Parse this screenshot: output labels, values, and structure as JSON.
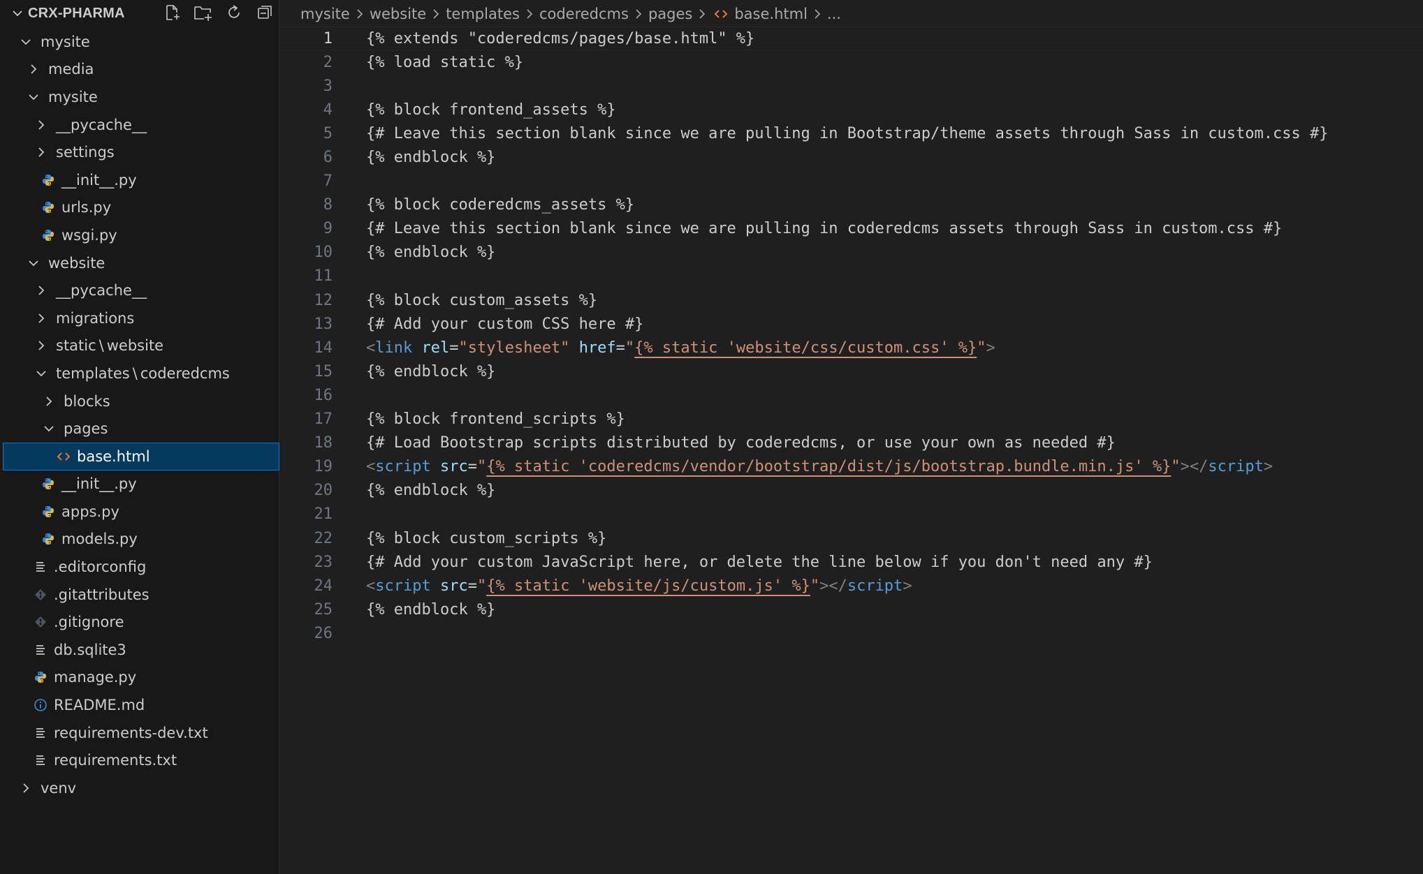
{
  "explorer": {
    "title": "CRX-PHARMA",
    "actions": [
      {
        "name": "new-file-icon"
      },
      {
        "name": "new-folder-icon"
      },
      {
        "name": "refresh-icon"
      },
      {
        "name": "collapse-all-icon"
      }
    ],
    "tree": [
      {
        "label": "mysite",
        "depth": 0,
        "kind": "folder",
        "open": true
      },
      {
        "label": "media",
        "depth": 1,
        "kind": "folder",
        "open": false
      },
      {
        "label": "mysite",
        "depth": 1,
        "kind": "folder",
        "open": true
      },
      {
        "label": "__pycache__",
        "depth": 2,
        "kind": "folder",
        "open": false
      },
      {
        "label": "settings",
        "depth": 2,
        "kind": "folder",
        "open": false
      },
      {
        "label": "__init__.py",
        "depth": 2,
        "kind": "python"
      },
      {
        "label": "urls.py",
        "depth": 2,
        "kind": "python"
      },
      {
        "label": "wsgi.py",
        "depth": 2,
        "kind": "python"
      },
      {
        "label": "website",
        "depth": 1,
        "kind": "folder",
        "open": true
      },
      {
        "label": "__pycache__",
        "depth": 2,
        "kind": "folder",
        "open": false
      },
      {
        "label": "migrations",
        "depth": 2,
        "kind": "folder",
        "open": false
      },
      {
        "label": "static",
        "label2": "website",
        "depth": 2,
        "kind": "folder",
        "open": false
      },
      {
        "label": "templates",
        "label2": "coderedcms",
        "depth": 2,
        "kind": "folder",
        "open": true
      },
      {
        "label": "blocks",
        "depth": 3,
        "kind": "folder",
        "open": false
      },
      {
        "label": "pages",
        "depth": 3,
        "kind": "folder",
        "open": true
      },
      {
        "label": "base.html",
        "depth": 4,
        "kind": "html",
        "selected": true
      },
      {
        "label": "__init__.py",
        "depth": 2,
        "kind": "python"
      },
      {
        "label": "apps.py",
        "depth": 2,
        "kind": "python"
      },
      {
        "label": "models.py",
        "depth": 2,
        "kind": "python"
      },
      {
        "label": ".editorconfig",
        "depth": 1,
        "kind": "lines"
      },
      {
        "label": ".gitattributes",
        "depth": 1,
        "kind": "git"
      },
      {
        "label": ".gitignore",
        "depth": 1,
        "kind": "git"
      },
      {
        "label": "db.sqlite3",
        "depth": 1,
        "kind": "lines"
      },
      {
        "label": "manage.py",
        "depth": 1,
        "kind": "python"
      },
      {
        "label": "README.md",
        "depth": 1,
        "kind": "info"
      },
      {
        "label": "requirements-dev.txt",
        "depth": 1,
        "kind": "lines"
      },
      {
        "label": "requirements.txt",
        "depth": 1,
        "kind": "lines"
      },
      {
        "label": "venv",
        "depth": 0,
        "kind": "folder",
        "open": false
      }
    ]
  },
  "breadcrumb": {
    "items": [
      "mysite",
      "website",
      "templates",
      "coderedcms",
      "pages",
      "base.html",
      "..."
    ]
  },
  "editor": {
    "current_line": 1,
    "lines": [
      [
        {
          "t": "plain",
          "v": "{% extends \"coderedcms/pages/base.html\" %}"
        }
      ],
      [
        {
          "t": "plain",
          "v": "{% load static %}"
        }
      ],
      [],
      [
        {
          "t": "plain",
          "v": "{% block frontend_assets %}"
        }
      ],
      [
        {
          "t": "plain",
          "v": "{# Leave this section blank since we are pulling in Bootstrap/theme assets through Sass in custom.css #}"
        }
      ],
      [
        {
          "t": "plain",
          "v": "{% endblock %}"
        }
      ],
      [],
      [
        {
          "t": "plain",
          "v": "{% block coderedcms_assets %}"
        }
      ],
      [
        {
          "t": "plain",
          "v": "{# Leave this section blank since we are pulling in coderedcms assets through Sass in custom.css #}"
        }
      ],
      [
        {
          "t": "plain",
          "v": "{% endblock %}"
        }
      ],
      [],
      [
        {
          "t": "plain",
          "v": "{% block custom_assets %}"
        }
      ],
      [
        {
          "t": "plain",
          "v": "{# Add your custom CSS here #}"
        }
      ],
      [
        {
          "t": "punct",
          "v": "<"
        },
        {
          "t": "tag",
          "v": "link"
        },
        {
          "t": "plain",
          "v": " "
        },
        {
          "t": "attr",
          "v": "rel"
        },
        {
          "t": "plain",
          "v": "="
        },
        {
          "t": "str",
          "v": "\"stylesheet\""
        },
        {
          "t": "plain",
          "v": " "
        },
        {
          "t": "attr",
          "v": "href"
        },
        {
          "t": "plain",
          "v": "="
        },
        {
          "t": "str",
          "v": "\""
        },
        {
          "t": "tpl",
          "v": "{% static 'website/css/custom.css' %}"
        },
        {
          "t": "str",
          "v": "\""
        },
        {
          "t": "punct",
          "v": ">"
        }
      ],
      [
        {
          "t": "plain",
          "v": "{% endblock %}"
        }
      ],
      [],
      [
        {
          "t": "plain",
          "v": "{% block frontend_scripts %}"
        }
      ],
      [
        {
          "t": "plain",
          "v": "{# Load Bootstrap scripts distributed by coderedcms, or use your own as needed #}"
        }
      ],
      [
        {
          "t": "punct",
          "v": "<"
        },
        {
          "t": "tag",
          "v": "script"
        },
        {
          "t": "plain",
          "v": " "
        },
        {
          "t": "attr",
          "v": "src"
        },
        {
          "t": "plain",
          "v": "="
        },
        {
          "t": "str",
          "v": "\""
        },
        {
          "t": "tpl",
          "v": "{% static 'coderedcms/vendor/bootstrap/dist/js/bootstrap.bundle.min.js' %}"
        },
        {
          "t": "str",
          "v": "\""
        },
        {
          "t": "punct",
          "v": "></"
        },
        {
          "t": "tag",
          "v": "script"
        },
        {
          "t": "punct",
          "v": ">"
        }
      ],
      [
        {
          "t": "plain",
          "v": "{% endblock %}"
        }
      ],
      [],
      [
        {
          "t": "plain",
          "v": "{% block custom_scripts %}"
        }
      ],
      [
        {
          "t": "plain",
          "v": "{# Add your custom JavaScript here, or delete the line below if you don't need any #}"
        }
      ],
      [
        {
          "t": "punct",
          "v": "<"
        },
        {
          "t": "tag",
          "v": "script"
        },
        {
          "t": "plain",
          "v": " "
        },
        {
          "t": "attr",
          "v": "src"
        },
        {
          "t": "plain",
          "v": "="
        },
        {
          "t": "str",
          "v": "\""
        },
        {
          "t": "tpl",
          "v": "{% static 'website/js/custom.js' %}"
        },
        {
          "t": "str",
          "v": "\""
        },
        {
          "t": "punct",
          "v": "></"
        },
        {
          "t": "tag",
          "v": "script"
        },
        {
          "t": "punct",
          "v": ">"
        }
      ],
      [
        {
          "t": "plain",
          "v": "{% endblock %}"
        }
      ],
      []
    ]
  },
  "colors": {
    "background": "#1f1f1f",
    "sidebar": "#181818",
    "selection": "#04395e",
    "selection_border": "#0078d4",
    "python_icon": "#3b8bd4",
    "html_icon": "#e37933",
    "tag": "#569cd6",
    "attr": "#9cdcfe",
    "string": "#ce9178"
  }
}
